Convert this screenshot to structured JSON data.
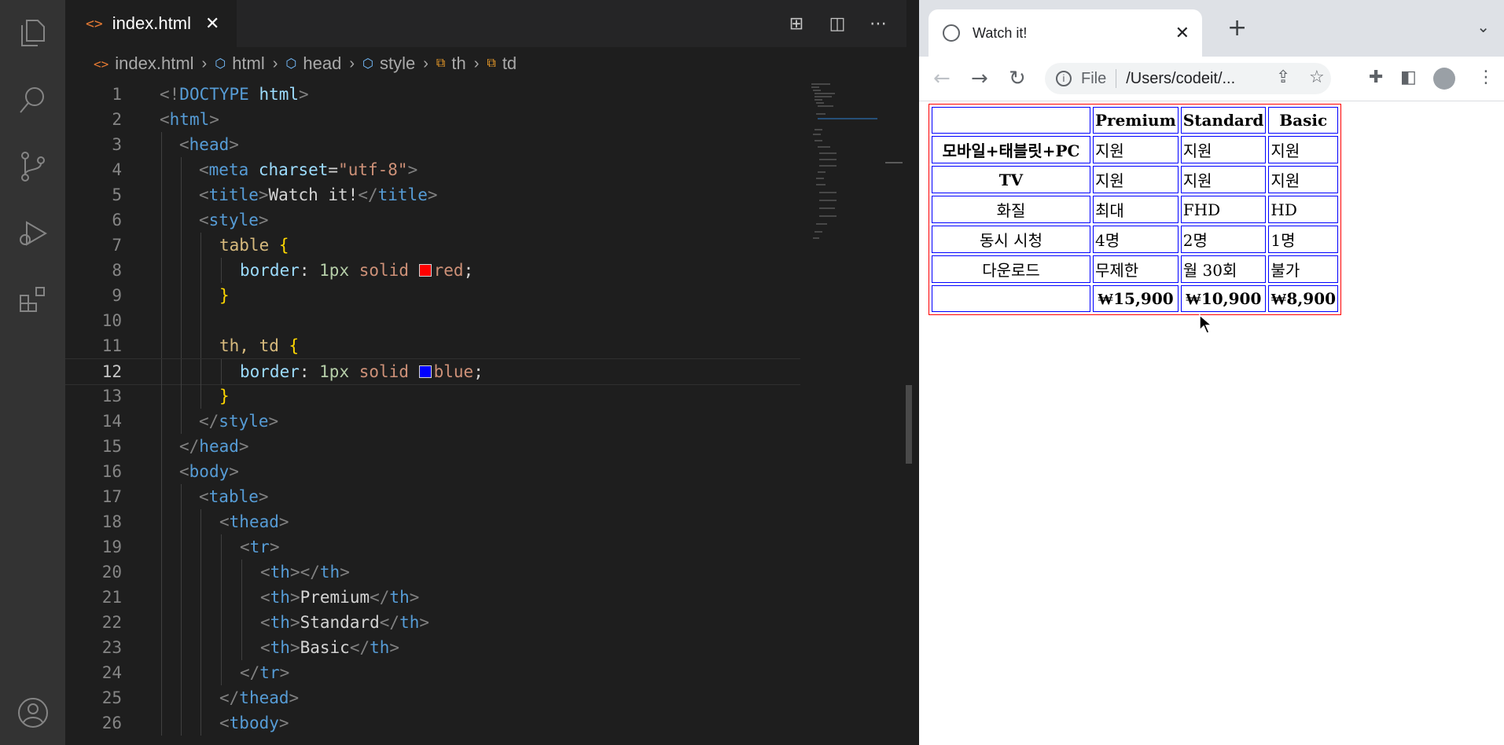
{
  "editor": {
    "tab": {
      "icon": "<>",
      "label": "index.html",
      "close": "✕"
    },
    "tab_actions": [
      "⊞",
      "◫",
      "⋯"
    ],
    "breadcrumb": [
      "index.html",
      "html",
      "head",
      "style",
      "th",
      "td"
    ],
    "active_line": 12,
    "lines": [
      {
        "n": "1"
      },
      {
        "n": "2"
      },
      {
        "n": "3"
      },
      {
        "n": "4"
      },
      {
        "n": "5"
      },
      {
        "n": "6"
      },
      {
        "n": "7"
      },
      {
        "n": "8"
      },
      {
        "n": "9"
      },
      {
        "n": "10"
      },
      {
        "n": "11"
      },
      {
        "n": "12"
      },
      {
        "n": "13"
      },
      {
        "n": "14"
      },
      {
        "n": "15"
      },
      {
        "n": "16"
      },
      {
        "n": "17"
      },
      {
        "n": "18"
      },
      {
        "n": "19"
      },
      {
        "n": "20"
      },
      {
        "n": "21"
      },
      {
        "n": "22"
      },
      {
        "n": "23"
      },
      {
        "n": "24"
      },
      {
        "n": "25"
      },
      {
        "n": "26"
      }
    ],
    "code": {
      "doctype": "DOCTYPE",
      "doctype_html": "html",
      "html": "html",
      "head": "head",
      "meta": "meta",
      "charset_attr": "charset",
      "charset_val": "\"utf-8\"",
      "title_tag": "title",
      "title_text": "Watch it!",
      "style_tag": "style",
      "table_sel": "table",
      "border_prop": "border",
      "border_num": "1px",
      "solid": "solid",
      "red": "red",
      "thtd_sel": "th, td",
      "blue": "blue",
      "body": "body",
      "table_tag": "table",
      "thead": "thead",
      "tr": "tr",
      "th": "th",
      "premium": "Premium",
      "standard": "Standard",
      "basic": "Basic",
      "tbody": "tbody"
    }
  },
  "browser": {
    "tab_title": "Watch it!",
    "tab_close": "✕",
    "new_tab": "+",
    "tab_menu": "⌄",
    "omnibox_scheme": "File",
    "omnibox_url": "/Users/codeit/...",
    "table": {
      "header": [
        "",
        "Premium",
        "Standard",
        "Basic"
      ],
      "rows": [
        [
          "모바일+태블릿+PC",
          "지원",
          "지원",
          "지원"
        ],
        [
          "TV",
          "지원",
          "지원",
          "지원"
        ],
        [
          "화질",
          "최대",
          "FHD",
          "HD"
        ],
        [
          "동시 시청",
          "4명",
          "2명",
          "1명"
        ],
        [
          "다운로드",
          "무제한",
          "월 30회",
          "불가"
        ],
        [
          "",
          "₩15,900",
          "₩10,900",
          "₩8,900"
        ]
      ]
    }
  },
  "colors": {
    "table_border": "#ff0000",
    "cell_border": "#0000ff"
  }
}
